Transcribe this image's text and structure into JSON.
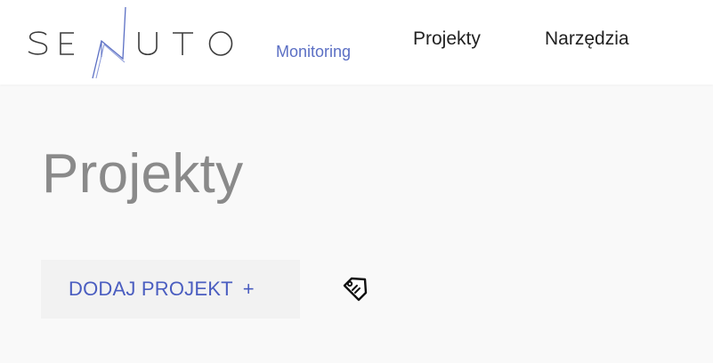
{
  "header": {
    "logo": {
      "brand_text": "SENUTO",
      "product_label": "Monitoring",
      "brand_color": "#3b3b3b",
      "accent_color": "#5b6fc4"
    },
    "nav": {
      "items": [
        {
          "label": "Projekty"
        },
        {
          "label": "Narzędzia"
        }
      ]
    }
  },
  "main": {
    "title": "Projekty",
    "toolbar": {
      "add_project_label": "DODAJ PROJEKT",
      "add_project_plus": "+",
      "add_project_color": "#4a5dc0",
      "tag_icon": "tag-icon"
    }
  }
}
